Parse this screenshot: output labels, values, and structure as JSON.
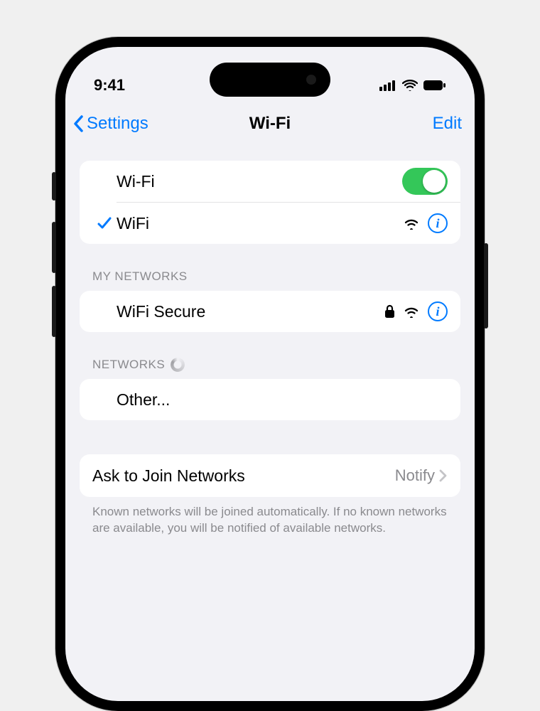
{
  "status": {
    "time": "9:41"
  },
  "nav": {
    "back": "Settings",
    "title": "Wi-Fi",
    "edit": "Edit"
  },
  "wifi": {
    "toggle_label": "Wi-Fi",
    "toggle_on": true,
    "connected": {
      "name": "WiFi"
    }
  },
  "sections": {
    "my_networks_header": "MY NETWORKS",
    "my_networks": [
      {
        "name": "WiFi Secure",
        "secure": true
      }
    ],
    "other_networks_header": "NETWORKS",
    "other_label": "Other..."
  },
  "ask": {
    "label": "Ask to Join Networks",
    "value": "Notify",
    "footer": "Known networks will be joined automatically. If no known networks are available, you will be notified of available networks."
  }
}
